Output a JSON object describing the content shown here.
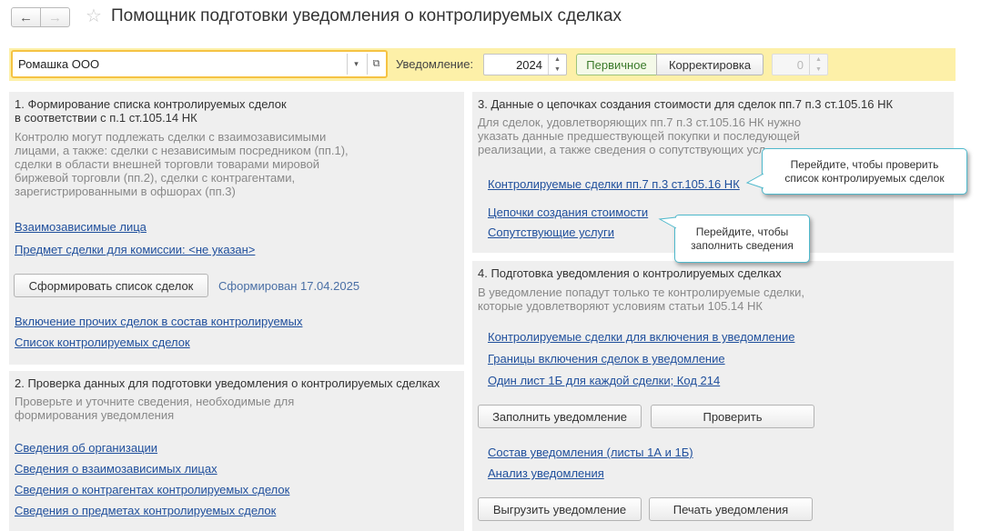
{
  "header": {
    "title": "Помощник подготовки уведомления о контролируемых сделках",
    "back_icon": "←",
    "forward_icon": "→",
    "favorite_icon": "☆"
  },
  "toolbar": {
    "organization": "Ромашка ООО",
    "dropdown_icon": "▾",
    "open_icon": "⧉",
    "notice_label": "Уведомление:",
    "year": "2024",
    "spin_up": "▲",
    "spin_down": "▼",
    "primary_label": "Первичное",
    "correction_label": "Корректировка",
    "correction_number": "0",
    "band_color": "#fdf0a8"
  },
  "section1": {
    "title_line1": "1. Формирование списка контролируемых сделок",
    "title_line2": "в соответствии с п.1 ст.105.14 НК",
    "desc": [
      "Контролю могут подлежать сделки с взаимозависимыми",
      "лицами, а также: сделки с независимым посредником (пп.1),",
      "сделки в области внешней торговли товарами мировой",
      "биржевой торговли (пп.2), сделки с контрагентами,",
      "зарегистрированными в офшорах (пп.3)"
    ],
    "link_related": "Взаимозависимые лица",
    "link_subject": "Предмет сделки для комиссии: <не указан>",
    "button_form": "Сформировать список сделок",
    "status": "Сформирован 17.04.2025",
    "link_include": "Включение прочих сделок в состав контролируемых",
    "link_list": "Список контролируемых сделок"
  },
  "section2": {
    "title": "2. Проверка данных для подготовки уведомления о контролируемых сделках",
    "desc": [
      "Проверьте и уточните сведения, необходимые для",
      "формирования уведомления"
    ],
    "links": [
      "Сведения об организации",
      "Сведения о взаимозависимых лицах",
      "Сведения о контрагентах контролируемых сделок",
      "Сведения о предметах контролируемых сделок"
    ]
  },
  "section3": {
    "title": "3. Данные о цепочках создания стоимости для сделок пп.7 п.3 ст.105.16 НК",
    "desc": [
      "Для сделок, удовлетворяющих пп.7 п.3 ст.105.16 НК нужно",
      "указать данные предшествующей покупки и последующей",
      "реализации, а также сведения о сопутствующих усл"
    ],
    "link_deals": "Контролируемые сделки пп.7 п.3 ст.105.16 НК",
    "link_chains": "Цепочки создания стоимости",
    "link_services": "Сопутствующие услуги"
  },
  "section4": {
    "title": "4. Подготовка уведомления о контролируемых сделках",
    "desc": [
      "В уведомление попадут только те контролируемые сделки,",
      "которые удовлетворяют условиям статьи 105.14 НК"
    ],
    "link_deals_include": "Контролируемые сделки для включения в уведомление",
    "link_bounds": "Границы включения сделок в уведомление",
    "link_one_sheet": "Один лист 1Б для каждой сделки; Код 214",
    "button_fill": "Заполнить уведомление",
    "button_check": "Проверить",
    "link_composition": "Состав уведомления (листы 1А и 1Б)",
    "link_analysis": "Анализ уведомления",
    "button_export": "Выгрузить уведомление",
    "button_print": "Печать уведомления"
  },
  "tooltips": {
    "tip1_line1": "Перейдите, чтобы проверить",
    "tip1_line2": "список контролируемых сделок",
    "tip2_line1": "Перейдите, чтобы",
    "tip2_line2": "заполнить сведения",
    "border_color": "#4fb9cc"
  }
}
